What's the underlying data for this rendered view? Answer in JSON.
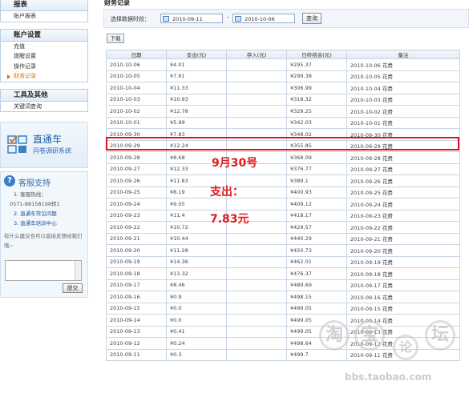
{
  "sidebar": {
    "sections": [
      {
        "title": "报表",
        "items": [
          {
            "label": "账户报表",
            "active": false
          }
        ]
      },
      {
        "title": "账户设置",
        "items": [
          {
            "label": "充值",
            "active": false
          },
          {
            "label": "提醒设置",
            "active": false
          },
          {
            "label": "操作记录",
            "active": false
          },
          {
            "label": "财务记录",
            "active": true
          }
        ]
      },
      {
        "title": "工具及其他",
        "items": [
          {
            "label": "关键词查询",
            "active": false
          }
        ]
      }
    ],
    "promo": {
      "title": "直通车",
      "subtitle": "问卷调研系统"
    },
    "support": {
      "title": "客服支持",
      "hotline_label": "1. 客服热线：",
      "hotline_number": "0571-88158198转1",
      "link2": "2. 直通车常见问题",
      "link3": "3. 直通车培训中心",
      "feedback_prompt": "有什么建议也可以直接反馈给我们哦~",
      "submit_label": "提交"
    }
  },
  "main": {
    "title": "财务记录",
    "filter_label": "选择数据时段：",
    "date_from": "2010-09-11",
    "date_to": "2010-10-06",
    "date_separator": "-",
    "query_label": "查询",
    "download_label": "下载"
  },
  "table": {
    "columns": [
      "日期",
      "支出(元)",
      "存入(元)",
      "日终结余(元)",
      "备注"
    ],
    "rows": [
      [
        "2010-10-06",
        "¥4.01",
        "",
        "¥295.37",
        "2010-10-06 花费"
      ],
      [
        "2010-10-05",
        "¥7.61",
        "",
        "¥299.38",
        "2010-10-05 花费"
      ],
      [
        "2010-10-04",
        "¥11.33",
        "",
        "¥306.99",
        "2010-10-04 花费"
      ],
      [
        "2010-10-03",
        "¥10.93",
        "",
        "¥318.32",
        "2010-10-03 花费"
      ],
      [
        "2010-10-02",
        "¥12.78",
        "",
        "¥329.25",
        "2010-10-02 花费"
      ],
      [
        "2010-10-01",
        "¥5.99",
        "",
        "¥342.03",
        "2010-10-01 花费"
      ],
      [
        "2010-09-30",
        "¥7.83",
        "",
        "¥348.02",
        "2010-09-30 花费"
      ],
      [
        "2010-09-29",
        "¥12.24",
        "",
        "¥355.85",
        "2010-09-29 花费"
      ],
      [
        "2010-09-28",
        "¥8.68",
        "",
        "¥368.09",
        "2010-09-28 花费"
      ],
      [
        "2010-09-27",
        "¥12.33",
        "",
        "¥376.77",
        "2010-09-27 花费"
      ],
      [
        "2010-09-26",
        "¥11.83",
        "",
        "¥389.1",
        "2010-09-26 花费"
      ],
      [
        "2010-09-25",
        "¥8.19",
        "",
        "¥400.93",
        "2010-09-25 花费"
      ],
      [
        "2010-09-24",
        "¥9.05",
        "",
        "¥409.12",
        "2010-09-24 花费"
      ],
      [
        "2010-09-23",
        "¥11.4",
        "",
        "¥418.17",
        "2010-09-23 花费"
      ],
      [
        "2010-09-22",
        "¥10.72",
        "",
        "¥429.57",
        "2010-09-22 花费"
      ],
      [
        "2010-09-21",
        "¥10.44",
        "",
        "¥440.29",
        "2010-09-21 花费"
      ],
      [
        "2010-09-20",
        "¥11.28",
        "",
        "¥450.73",
        "2010-09-20 花费"
      ],
      [
        "2010-09-19",
        "¥14.36",
        "",
        "¥462.01",
        "2010-09-19 花费"
      ],
      [
        "2010-09-18",
        "¥13.32",
        "",
        "¥476.37",
        "2010-09-18 花费"
      ],
      [
        "2010-09-17",
        "¥8.46",
        "",
        "¥489.69",
        "2010-09-17 花费"
      ],
      [
        "2010-09-16",
        "¥0.9",
        "",
        "¥498.15",
        "2010-09-16 花费"
      ],
      [
        "2010-09-15",
        "¥0.0",
        "",
        "¥499.05",
        "2010-09-15 花费"
      ],
      [
        "2010-09-14",
        "¥0.0",
        "",
        "¥499.05",
        "2010-09-14 花费"
      ],
      [
        "2010-09-13",
        "¥0.41",
        "",
        "¥499.05",
        "2010-09-13 花费"
      ],
      [
        "2010-09-12",
        "¥0.24",
        "",
        "¥498.64",
        "2010-09-12 花费"
      ],
      [
        "2010-09-11",
        "¥0.3",
        "",
        "¥499.7",
        "2010-09-11 花费"
      ]
    ],
    "highlighted_row": "2010-09-30"
  },
  "annotation": {
    "line1": "9月30号",
    "line2": "支出：",
    "line3": "7.83元",
    "color": "#e01b1b"
  },
  "watermark": {
    "chars": [
      "淘",
      "宝",
      "论",
      "坛"
    ],
    "url": "bbs.taobao.com"
  }
}
